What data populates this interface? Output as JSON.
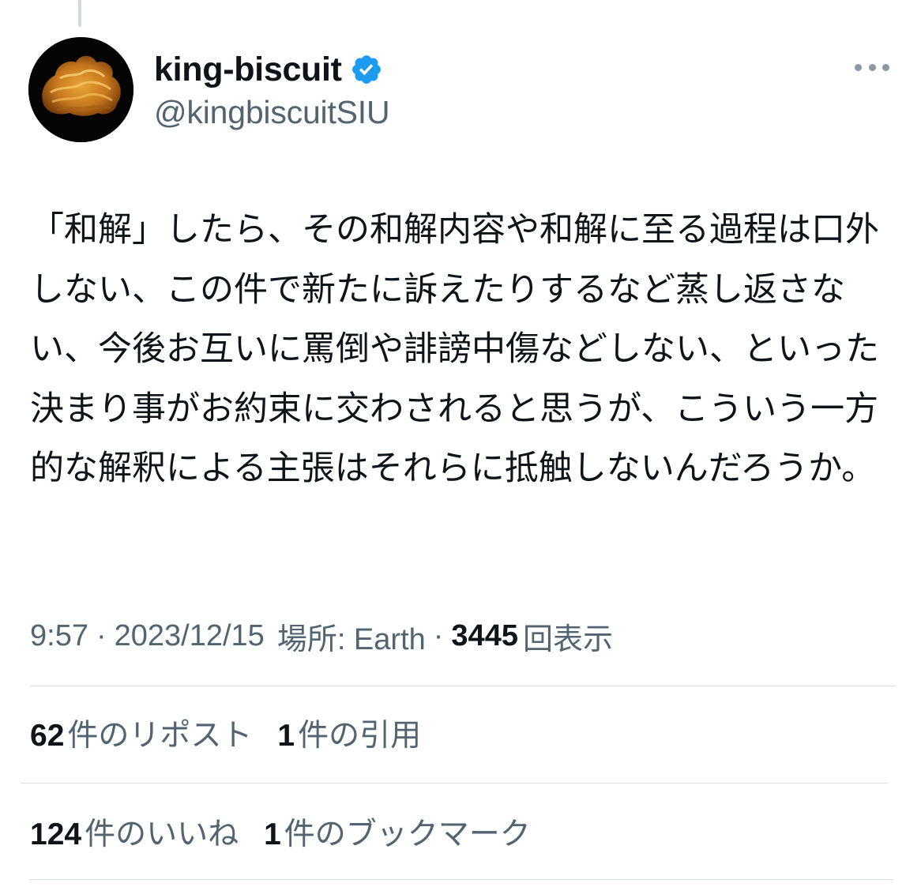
{
  "user": {
    "display_name": "king-biscuit",
    "handle": "@kingbiscuitSIU",
    "avatar_icon": "biscuit-photo",
    "verified_icon": "verified-badge-icon",
    "verified_color": "#1d9bf0"
  },
  "tweet": {
    "text": "「和解」したら、その和解内容や和解に至る過程は口外しない、この件で新たに訴えたりするなど蒸し返さない、今後お互いに罵倒や誹謗中傷などしない、といった決まり事がお約束に交わされると思うが、こういう一方的な解釈による主張はそれらに抵触しないんだろうか。"
  },
  "meta": {
    "time": "9:57",
    "separator": "·",
    "date": "2023/12/15",
    "location": "場所: Earth",
    "views_count": "3445",
    "views_label": "回表示"
  },
  "stats": {
    "reposts_count": "62",
    "reposts_label": "件のリポスト",
    "quotes_count": "1",
    "quotes_label": "件の引用",
    "likes_count": "124",
    "likes_label": "件のいいね",
    "bookmarks_count": "1",
    "bookmarks_label": "件のブックマーク"
  },
  "colors": {
    "text_primary": "#0f1419",
    "text_secondary": "#536471",
    "divider": "#d8dee2"
  }
}
